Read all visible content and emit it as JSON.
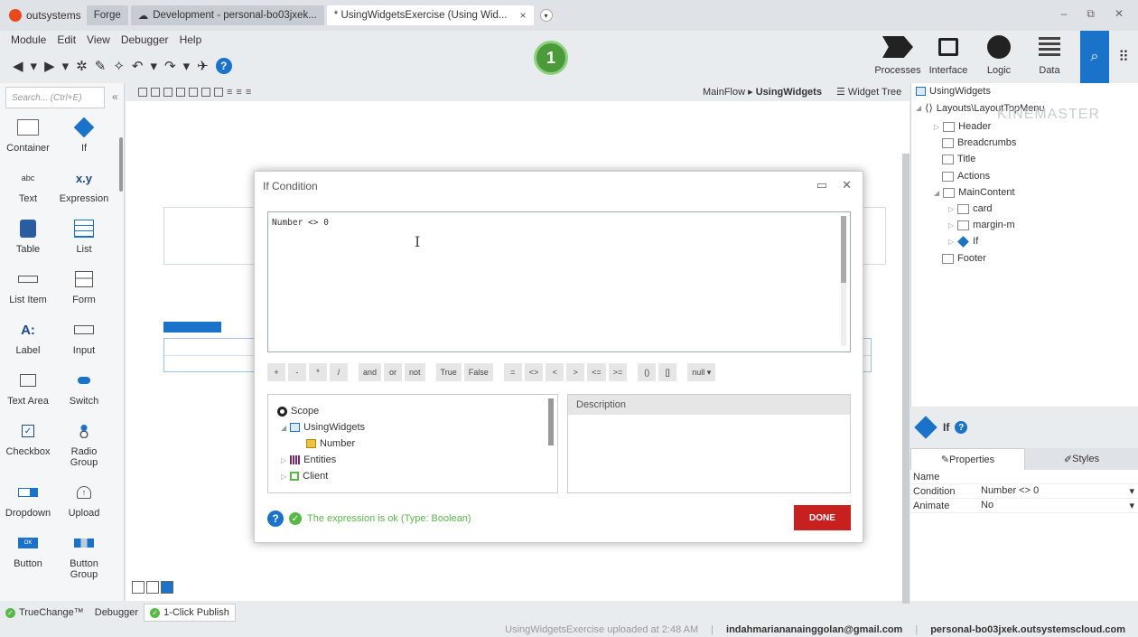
{
  "tabs": {
    "brand": "outsystems",
    "forge": "Forge",
    "development": "Development - personal-bo03jxek...",
    "active": "* UsingWidgetsExercise (Using Wid...",
    "close": "×",
    "add": "▾"
  },
  "window": {
    "minimize": "–",
    "restore": "⧉",
    "close": "✕"
  },
  "menu": [
    "Module",
    "Edit",
    "View",
    "Debugger",
    "Help"
  ],
  "toolbar": {
    "step_badge": "1",
    "back": "◀",
    "forward": "▶",
    "help": "?"
  },
  "layers": [
    {
      "label": "Processes"
    },
    {
      "label": "Interface"
    },
    {
      "label": "Logic"
    },
    {
      "label": "Data"
    }
  ],
  "palette": {
    "search_placeholder": "Search... (Ctrl+E)",
    "collapse": "«",
    "items": [
      {
        "label": "Container",
        "icon": "container-icon"
      },
      {
        "label": "If",
        "icon": "if-icon"
      },
      {
        "label": "Text",
        "glyph": "abc",
        "icon": "text-icon"
      },
      {
        "label": "Expression",
        "glyph": "x.y",
        "icon": "expression-icon"
      },
      {
        "label": "Table",
        "icon": "table-icon"
      },
      {
        "label": "List",
        "icon": "list-icon"
      },
      {
        "label": "List Item",
        "icon": "list-item-icon"
      },
      {
        "label": "Form",
        "icon": "form-icon"
      },
      {
        "label": "Label",
        "glyph": "A:",
        "icon": "label-icon"
      },
      {
        "label": "Input",
        "icon": "input-icon"
      },
      {
        "label": "Text Area",
        "icon": "text-area-icon"
      },
      {
        "label": "Switch",
        "icon": "switch-icon"
      },
      {
        "label": "Checkbox",
        "glyph": "✓",
        "icon": "checkbox-icon"
      },
      {
        "label": "Radio Group",
        "icon": "radio-group-icon"
      },
      {
        "label": "Dropdown",
        "icon": "dropdown-icon"
      },
      {
        "label": "Upload",
        "glyph": "↑",
        "icon": "upload-icon"
      },
      {
        "label": "Button",
        "glyph": "OK",
        "icon": "button-icon"
      },
      {
        "label": "Button Group",
        "icon": "button-group-icon"
      }
    ]
  },
  "canvas": {
    "breadcrumb_flow": "MainFlow ▸ ",
    "breadcrumb_screen": "UsingWidgets",
    "widget_tree_tab": "Widget Tree"
  },
  "widget_tree": {
    "root": "UsingWidgets",
    "layout": "Layouts\\LayoutTopMenu",
    "nodes": [
      "Header",
      "Breadcrumbs",
      "Title",
      "Actions",
      "MainContent",
      "card",
      "margin-m",
      "If",
      "Footer"
    ],
    "watermark": "KINEMASTER"
  },
  "properties": {
    "widget_name": "If",
    "tab_properties": "Properties",
    "tab_styles": "Styles",
    "rows": [
      {
        "key": "Name",
        "value": ""
      },
      {
        "key": "Condition",
        "value": "Number <> 0"
      },
      {
        "key": "Animate",
        "value": "No"
      }
    ]
  },
  "bottom_tabs": {
    "truechange": "TrueChange™",
    "debugger": "Debugger",
    "publish": "1-Click Publish"
  },
  "statusbar": {
    "uploaded": "UsingWidgetsExercise uploaded at 2:48 AM",
    "user": "indahmariananainggolan@gmail.com",
    "server": "personal-bo03jxek.outsystemscloud.com"
  },
  "modal": {
    "title": "If Condition",
    "expression": "Number <> 0",
    "operators": [
      "+",
      "-",
      "*",
      "/",
      "|",
      "and",
      "or",
      "not",
      "|",
      "True",
      "False",
      "|",
      "=",
      "<>",
      "<",
      ">",
      "<=",
      ">=",
      "|",
      "()",
      "[]",
      "|",
      "null ▾"
    ],
    "scope_root": "Scope",
    "scope_screen": "UsingWidgets",
    "scope_var": "Number",
    "scope_entities": "Entities",
    "scope_client": "Client",
    "description_header": "Description",
    "status": "The expression is ok (Type: Boolean)",
    "done": "DONE"
  }
}
